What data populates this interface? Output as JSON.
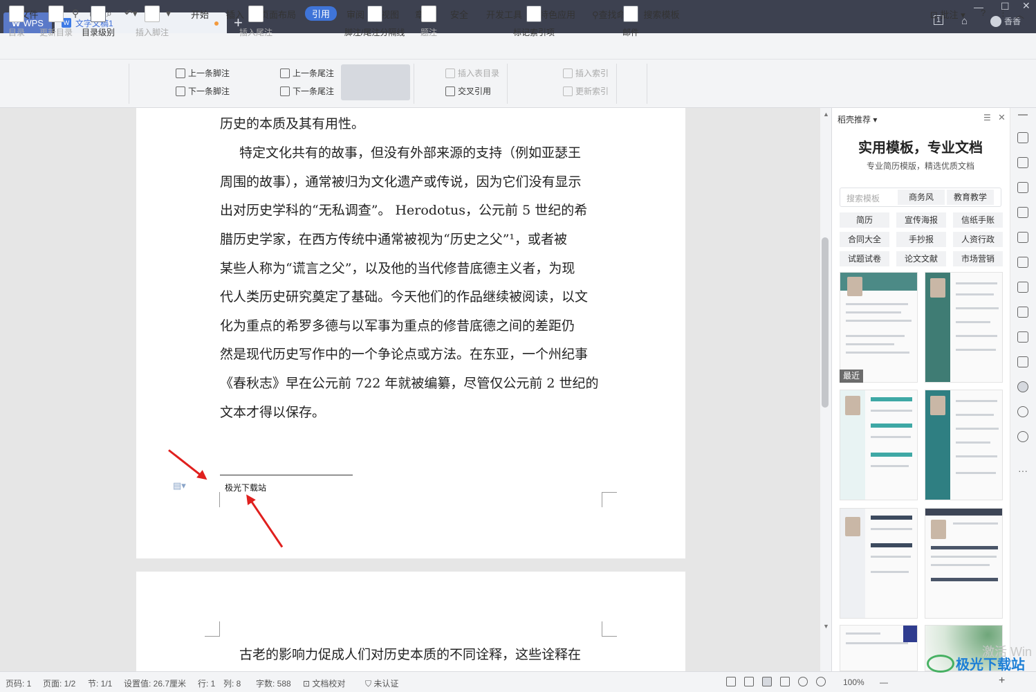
{
  "titlebar": {
    "app_tab": "WPS",
    "doc_tab": "文字文稿1",
    "new_tab": "+",
    "user": "香香",
    "badge": "1"
  },
  "menubar": {
    "file": "文件",
    "items": [
      "开始",
      "插入",
      "页面布局",
      "引用",
      "审阅",
      "视图",
      "章节",
      "安全",
      "开发工具",
      "特色应用"
    ],
    "active": "引用",
    "search": "查找命令、搜索模板",
    "annotate": "批注",
    "help": "?"
  },
  "ribbon": {
    "toc": "目录",
    "update_toc": "更新目录",
    "toc_level": "目录级别",
    "insert_footnote": "插入脚注",
    "prev_footnote": "上一条脚注",
    "next_footnote": "下一条脚注",
    "insert_endnote": "插入尾注",
    "prev_endnote": "上一条尾注",
    "next_endnote": "下一条尾注",
    "separator": "脚注/尾注分隔线",
    "caption": "题注",
    "insert_table_toc": "插入表目录",
    "cross_ref": "交叉引用",
    "mark_index": "标记索引项",
    "insert_index": "插入索引",
    "update_index": "更新索引",
    "mail": "邮件"
  },
  "document": {
    "lines": [
      "历史的本质及其有用性。",
      "特定文化共有的故事，但没有外部来源的支持（例如亚瑟王",
      "周围的故事），通常被归为文化遗产或传说，因为它们没有显示",
      "出对历史学科的“无私调查”。 Herodotus，公元前 5 世纪的希",
      "腊历史学家，在西方传统中通常被视为“历史之父”¹，或者被",
      "某些人称为“谎言之父”，以及他的当代修昔底德主义者，为现",
      "代人类历史研究奠定了基础。今天他们的作品继续被阅读，以文",
      "化为重点的希罗多德与以军事为重点的修昔底德之间的差距仍",
      "然是现代历史写作中的一个争论点或方法。在东亚，一个州纪事",
      "《春秋志》早在公元前 722 年就被编纂，尽管仅公元前 2 世纪的",
      "文本才得以保存。"
    ],
    "footnote": "极光下载站",
    "page2_line": "古老的影响力促成人们对历史本质的不同诠释，这些诠释在"
  },
  "panel": {
    "header": "稻壳推荐",
    "title": "实用模板，专业文档",
    "subtitle": "专业简历模版，精选优质文档",
    "search_placeholder": "搜索模板",
    "search_tags": [
      "商务风",
      "教育教学"
    ],
    "categories": [
      "简历",
      "宣传海报",
      "信纸手账",
      "合同大全",
      "手抄报",
      "人资行政",
      "试题试卷",
      "论文文献",
      "市场营销"
    ],
    "recent": "最近"
  },
  "statusbar": {
    "page_code": "页码: 1",
    "page": "页面: 1/2",
    "section": "节: 1/1",
    "setting": "设置值: 26.7厘米",
    "row": "行: 1",
    "col": "列: 8",
    "words": "字数: 588",
    "proof": "文档校对",
    "cert": "未认证",
    "zoom": "100%",
    "minus": "—",
    "plus": "+"
  },
  "watermark": {
    "brand": "极光下载站",
    "ghost": "激活 Win"
  },
  "colors": {
    "titlebar": "#3d4150",
    "accent": "#3f74d8",
    "arrow": "#e0201e"
  }
}
